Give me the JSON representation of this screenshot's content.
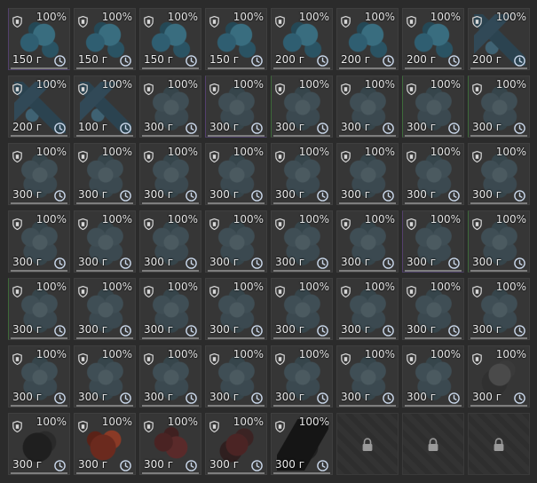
{
  "inventory": {
    "slots": [
      {
        "condition": "100%",
        "weight": "150 г",
        "art": "blue-ore",
        "edge": "purple"
      },
      {
        "condition": "100%",
        "weight": "150 г",
        "art": "blue-ore"
      },
      {
        "condition": "100%",
        "weight": "150 г",
        "art": "blue-ore"
      },
      {
        "condition": "100%",
        "weight": "150 г",
        "art": "blue-ore"
      },
      {
        "condition": "100%",
        "weight": "200 г",
        "art": "blue-ore"
      },
      {
        "condition": "100%",
        "weight": "200 г",
        "art": "blue-ore"
      },
      {
        "condition": "100%",
        "weight": "200 г",
        "art": "blue-ore"
      },
      {
        "condition": "100%",
        "weight": "200 г",
        "art": "crystal"
      },
      {
        "condition": "100%",
        "weight": "200 г",
        "art": "crystal"
      },
      {
        "condition": "100%",
        "weight": "100 г",
        "art": "crystal"
      },
      {
        "condition": "100%",
        "weight": "300 г",
        "art": "gray-flower"
      },
      {
        "condition": "100%",
        "weight": "300 г",
        "art": "gray-flower",
        "edge": "purple"
      },
      {
        "condition": "100%",
        "weight": "300 г",
        "art": "gray-flower",
        "edge": "green"
      },
      {
        "condition": "100%",
        "weight": "300 г",
        "art": "gray-flower"
      },
      {
        "condition": "100%",
        "weight": "300 г",
        "art": "gray-flower",
        "edge": "green"
      },
      {
        "condition": "100%",
        "weight": "300 г",
        "art": "gray-flower",
        "edge": "green"
      },
      {
        "condition": "100%",
        "weight": "300 г",
        "art": "gray-flower"
      },
      {
        "condition": "100%",
        "weight": "300 г",
        "art": "gray-flower"
      },
      {
        "condition": "100%",
        "weight": "300 г",
        "art": "gray-flower"
      },
      {
        "condition": "100%",
        "weight": "300 г",
        "art": "gray-flower"
      },
      {
        "condition": "100%",
        "weight": "300 г",
        "art": "gray-flower"
      },
      {
        "condition": "100%",
        "weight": "300 г",
        "art": "gray-flower"
      },
      {
        "condition": "100%",
        "weight": "300 г",
        "art": "gray-flower"
      },
      {
        "condition": "100%",
        "weight": "300 г",
        "art": "gray-flower"
      },
      {
        "condition": "100%",
        "weight": "300 г",
        "art": "gray-flower"
      },
      {
        "condition": "100%",
        "weight": "300 г",
        "art": "gray-flower"
      },
      {
        "condition": "100%",
        "weight": "300 г",
        "art": "gray-flower"
      },
      {
        "condition": "100%",
        "weight": "300 г",
        "art": "gray-flower"
      },
      {
        "condition": "100%",
        "weight": "300 г",
        "art": "gray-flower"
      },
      {
        "condition": "100%",
        "weight": "300 г",
        "art": "gray-flower"
      },
      {
        "condition": "100%",
        "weight": "300 г",
        "art": "gray-flower",
        "edge": "purple"
      },
      {
        "condition": "100%",
        "weight": "300 г",
        "art": "gray-flower",
        "edge": "green"
      },
      {
        "condition": "100%",
        "weight": "300 г",
        "art": "gray-flower",
        "edge": "green"
      },
      {
        "condition": "100%",
        "weight": "300 г",
        "art": "gray-flower"
      },
      {
        "condition": "100%",
        "weight": "300 г",
        "art": "gray-flower"
      },
      {
        "condition": "100%",
        "weight": "300 г",
        "art": "gray-flower"
      },
      {
        "condition": "100%",
        "weight": "300 г",
        "art": "gray-flower"
      },
      {
        "condition": "100%",
        "weight": "300 г",
        "art": "gray-flower"
      },
      {
        "condition": "100%",
        "weight": "300 г",
        "art": "gray-flower"
      },
      {
        "condition": "100%",
        "weight": "300 г",
        "art": "gray-flower"
      },
      {
        "condition": "100%",
        "weight": "300 г",
        "art": "gray-flower"
      },
      {
        "condition": "100%",
        "weight": "300 г",
        "art": "gray-flower"
      },
      {
        "condition": "100%",
        "weight": "300 г",
        "art": "gray-flower"
      },
      {
        "condition": "100%",
        "weight": "300 г",
        "art": "gray-flower"
      },
      {
        "condition": "100%",
        "weight": "300 г",
        "art": "gray-flower"
      },
      {
        "condition": "100%",
        "weight": "300 г",
        "art": "gray-flower"
      },
      {
        "condition": "100%",
        "weight": "300 г",
        "art": "gray-flower"
      },
      {
        "condition": "100%",
        "weight": "300 г",
        "art": "dark-rose"
      },
      {
        "condition": "100%",
        "weight": "300 г",
        "art": "dark-lump"
      },
      {
        "condition": "100%",
        "weight": "300 г",
        "art": "red-crystal"
      },
      {
        "condition": "100%",
        "weight": "300 г",
        "art": "red-cluster"
      },
      {
        "condition": "100%",
        "weight": "300 г",
        "art": "red-dark-rose"
      },
      {
        "condition": "100%",
        "weight": "300 г",
        "art": "black-shard"
      },
      {
        "locked": true
      },
      {
        "locked": true
      },
      {
        "locked": true
      }
    ]
  },
  "icons": {
    "shield": "shield-icon",
    "clock": "clock-icon",
    "lock": "lock-icon"
  },
  "colors": {
    "background": "#2b2b2b",
    "cell": "#363636",
    "text": "#e6e6e6",
    "clock": "#c9d7ea"
  }
}
